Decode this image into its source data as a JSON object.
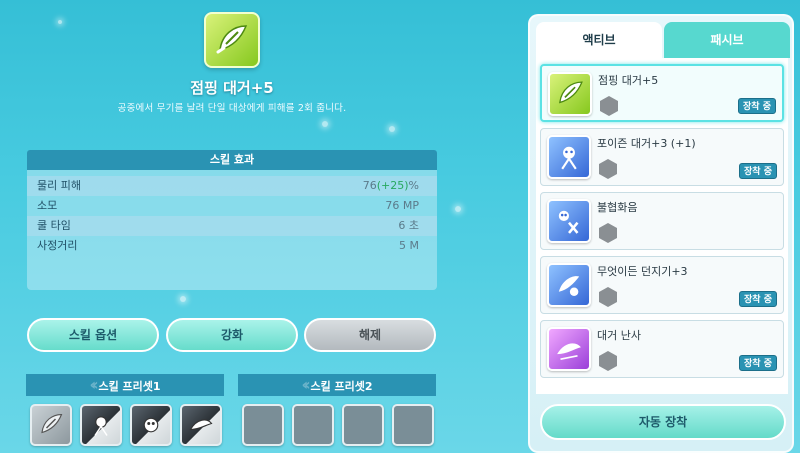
{
  "skill": {
    "name": "점핑 대거+5",
    "description": "공중에서 무기를 날려 단일 대상에게 피해를 2회 줍니다.",
    "icon": "dagger-jump-icon"
  },
  "effect": {
    "header": "스킬 효과",
    "rows": [
      {
        "label": "물리 피해",
        "value": "76",
        "bonus": "(+25)",
        "suffix": "%"
      },
      {
        "label": "소모",
        "value": "76 MP"
      },
      {
        "label": "쿨 타임",
        "value": "6 초"
      },
      {
        "label": "사정거리",
        "value": "5 M"
      }
    ]
  },
  "buttons": {
    "options": "스킬 옵션",
    "enhance": "강화",
    "release": "해제"
  },
  "presets": [
    {
      "label": "스킬 프리셋1"
    },
    {
      "label": "스킬 프리셋2"
    }
  ],
  "tabs": {
    "active": "액티브",
    "passive": "패시브"
  },
  "skill_list": [
    {
      "name": "점핑 대거+5",
      "equipped": "장착 중",
      "icon": "dagger-jump-icon",
      "color": "green"
    },
    {
      "name": "포이즌 대거+3 (+1)",
      "equipped": "장착 중",
      "icon": "poison-dagger-icon",
      "color": "blue"
    },
    {
      "name": "불협화음",
      "equipped": "",
      "icon": "skull-discord-icon",
      "color": "blue"
    },
    {
      "name": "무엇이든 던지기+3",
      "equipped": "장착 중",
      "icon": "throw-anything-icon",
      "color": "blue"
    },
    {
      "name": "대거 난사",
      "equipped": "장착 중",
      "icon": "dagger-barrage-icon",
      "color": "purple"
    }
  ],
  "auto_equip": "자동 장착",
  "colors": {
    "accent": "#2a93b3",
    "tab_inactive": "#57d8cf",
    "button_teal": "#66dccb"
  }
}
